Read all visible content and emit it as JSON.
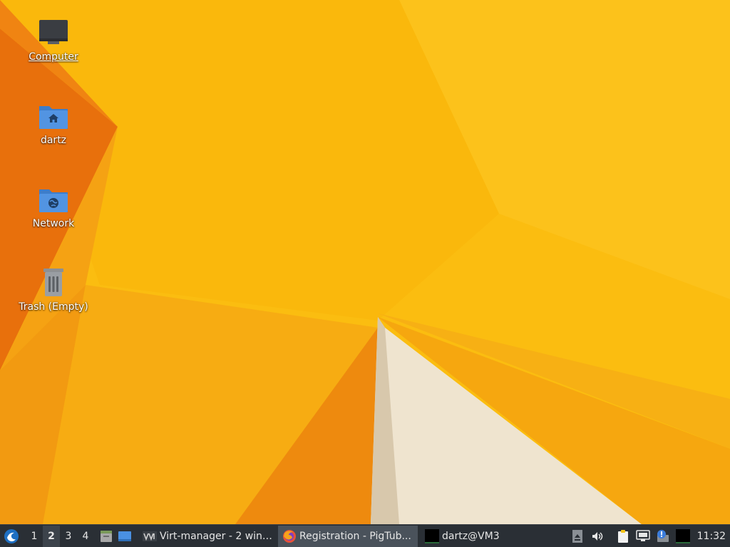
{
  "desktop": {
    "icons": [
      {
        "label": "Computer",
        "icon": "computer-icon"
      },
      {
        "label": "dartz",
        "icon": "home-folder-icon"
      },
      {
        "label": "Network",
        "icon": "network-folder-icon"
      },
      {
        "label": "Trash (Empty)",
        "icon": "trash-icon"
      }
    ]
  },
  "taskbar": {
    "workspaces": [
      "1",
      "2",
      "3",
      "4"
    ],
    "active_workspace": "2",
    "tasks": [
      {
        "label": "Virt-manager - 2 wind...",
        "icon": "virt-manager-icon"
      },
      {
        "label": "Registration - PigTub...",
        "icon": "firefox-icon"
      },
      {
        "label": "dartz@VM3",
        "icon": "terminal-icon"
      }
    ],
    "clock": "11:32"
  },
  "colors": {
    "wallpaper_base": "#f9b90e",
    "wallpaper_orange": "#e8730a",
    "taskbar_bg": "#2a2f35",
    "folder_blue": "#5294e2"
  }
}
